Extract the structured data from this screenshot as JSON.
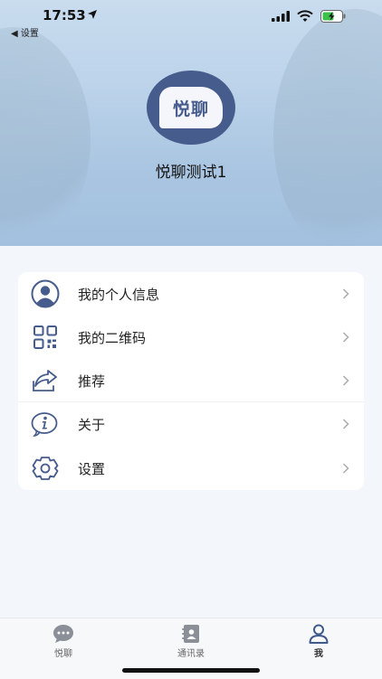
{
  "status_bar": {
    "time": "17:53",
    "back_label": "◀ 设置"
  },
  "profile": {
    "avatar_text": "悦聊",
    "name": "悦聊测试1"
  },
  "menu": {
    "items": [
      {
        "label": "我的个人信息",
        "icon": "user-avatar-icon"
      },
      {
        "label": "我的二维码",
        "icon": "qr-code-icon"
      },
      {
        "label": "推荐",
        "icon": "share-icon"
      },
      {
        "label": "关于",
        "icon": "info-icon"
      },
      {
        "label": "设置",
        "icon": "gear-icon"
      }
    ]
  },
  "tabbar": {
    "tabs": [
      {
        "label": "悦聊",
        "icon": "chat-bubble-icon"
      },
      {
        "label": "通讯录",
        "icon": "contacts-book-icon"
      },
      {
        "label": "我",
        "icon": "person-icon",
        "active": true
      }
    ]
  },
  "colors": {
    "brand": "#465c8c",
    "header_sky": "#bcd3ea",
    "background": "#f3f6fa"
  }
}
